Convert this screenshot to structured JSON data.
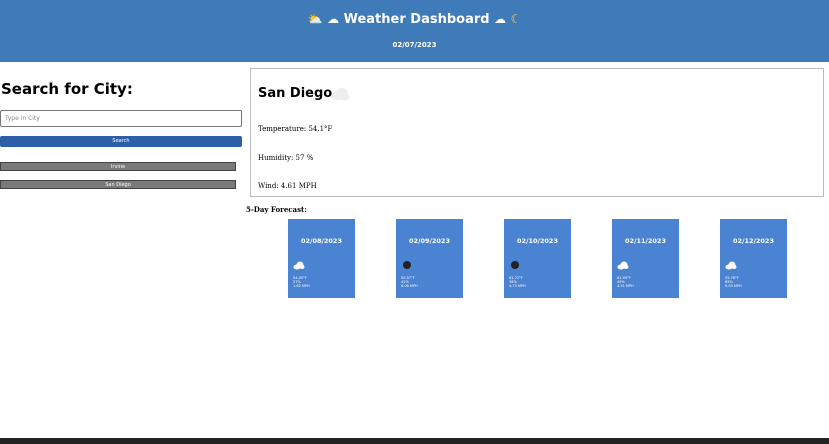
{
  "header": {
    "title": "Weather Dashboard",
    "date": "02/07/2023"
  },
  "sidebar": {
    "heading": "Search for City:",
    "input_placeholder": "Type in City",
    "search_label": "Search",
    "history": [
      "Irvine",
      "San Diego"
    ]
  },
  "current": {
    "city": "San Diego",
    "icon": "cloud-icon",
    "temperature": "Temperature: 54.1°F",
    "humidity": "Humidity: 57 %",
    "wind": "Wind: 4.61 MPH"
  },
  "forecast": {
    "heading": "5-Day Forecast:",
    "days": [
      {
        "date": "02/08/2023",
        "icon": "cloud-icon",
        "temp": "54.05°F",
        "humidity": "57%",
        "wind": "1.62 MPH"
      },
      {
        "date": "02/09/2023",
        "icon": "dark-circle-icon",
        "temp": "50.57°F",
        "humidity": "42%",
        "wind": "6.06 MPH"
      },
      {
        "date": "02/10/2023",
        "icon": "dark-circle-icon",
        "temp": "61.72°F",
        "humidity": "36%",
        "wind": "4.73 MPH"
      },
      {
        "date": "02/11/2023",
        "icon": "cloud-icon",
        "temp": "61.99°F",
        "humidity": "49%",
        "wind": "4.51 MPH"
      },
      {
        "date": "02/12/2023",
        "icon": "cloud-icon",
        "temp": "55.76°F",
        "humidity": "65%",
        "wind": "9.05 MPH"
      }
    ]
  },
  "colors": {
    "header": "#3f7bb8",
    "search_button": "#2c5fa8",
    "history_button": "#7a7a7a",
    "card": "#4a83d2"
  }
}
